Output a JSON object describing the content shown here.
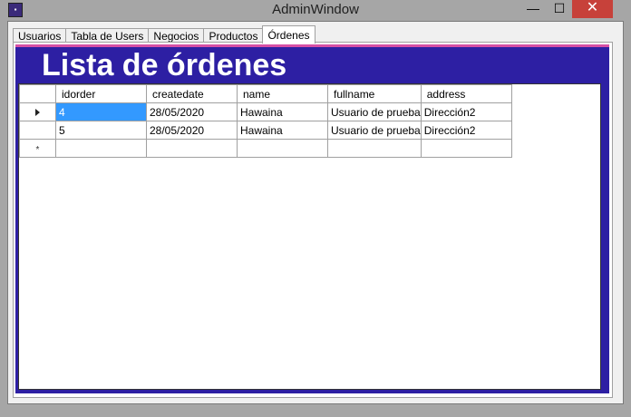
{
  "window": {
    "title": "AdminWindow",
    "icon": "app-icon",
    "controls": {
      "minimize": "—",
      "maximize": "☐",
      "close": "✕"
    }
  },
  "tabs": [
    {
      "label": "Usuarios",
      "active": false
    },
    {
      "label": "Tabla de Users",
      "active": false
    },
    {
      "label": "Negocios",
      "active": false
    },
    {
      "label": "Productos",
      "active": false
    },
    {
      "label": "Órdenes",
      "active": true
    }
  ],
  "page": {
    "heading": "Lista de órdenes",
    "colors": {
      "panel": "#2d1fa3",
      "accent": "#d64fa5",
      "selection": "#3399ff"
    }
  },
  "grid": {
    "columns": [
      "idorder",
      "createdate",
      "name",
      "fullname",
      "address"
    ],
    "rows": [
      [
        "4",
        "28/05/2020",
        "Hawaina",
        "Usuario de prueba",
        "Dirección2"
      ],
      [
        "5",
        "28/05/2020",
        "Hawaina",
        "Usuario de prueba",
        "Dirección2"
      ]
    ],
    "new_row_marker": "*",
    "current_row_marker": "row-indicator-arrow"
  }
}
